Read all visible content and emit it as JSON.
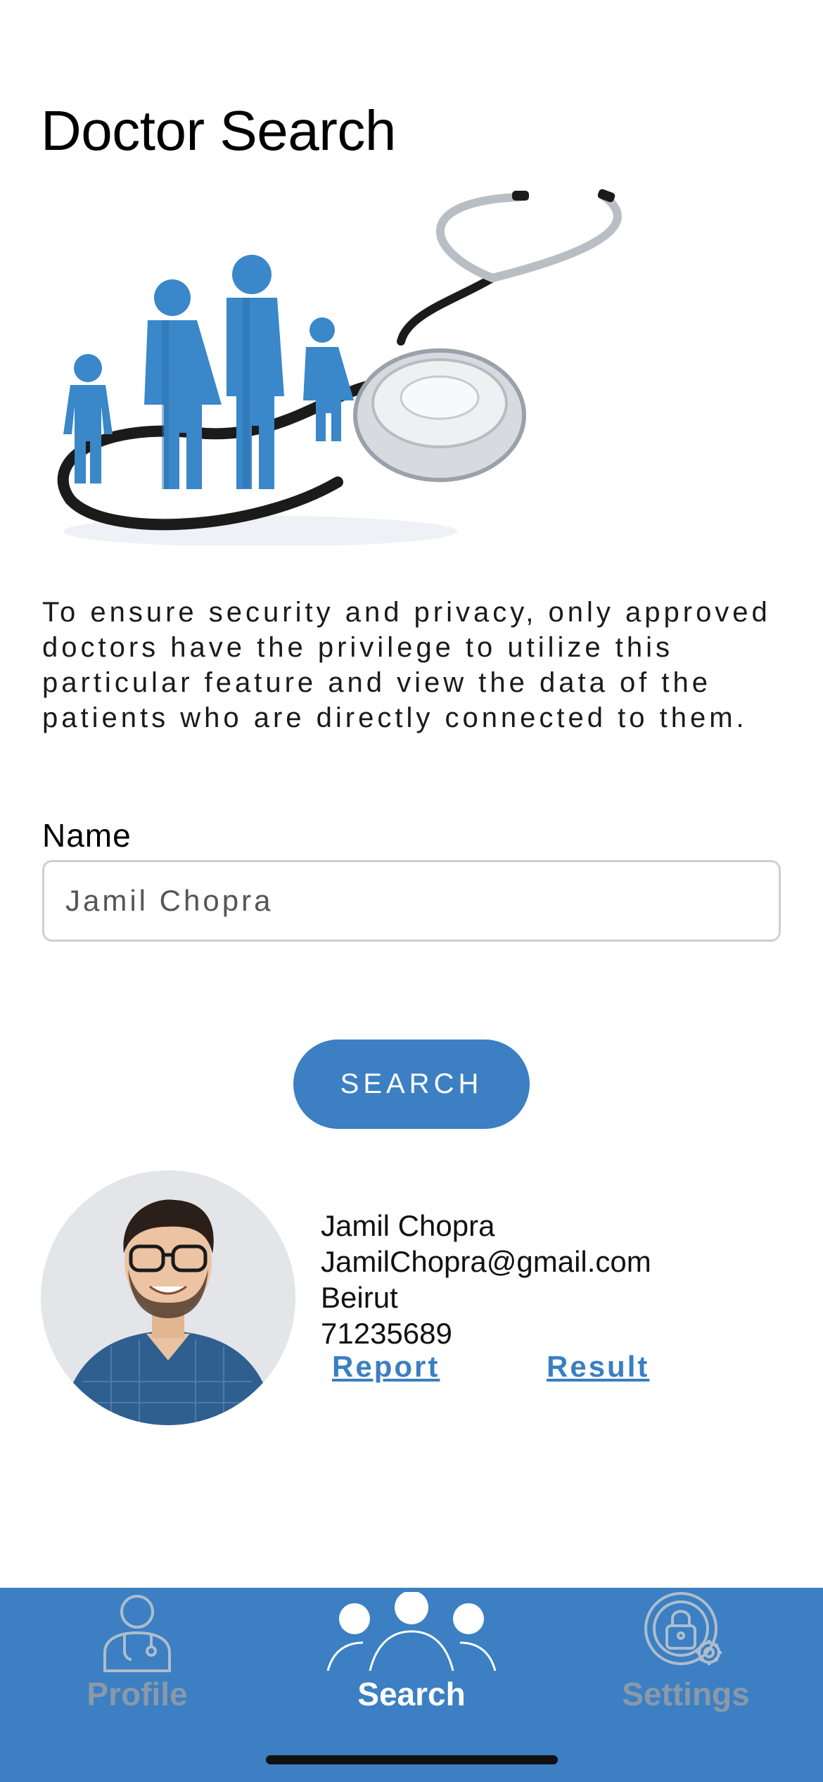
{
  "page": {
    "title": "Doctor Search",
    "notice": "To ensure security and privacy, only approved doctors have the privilege to utilize this particular feature and view the data of the patients who are directly connected to them."
  },
  "form": {
    "name_label": "Name",
    "name_value": "Jamil Chopra",
    "search_label": "SEARCH"
  },
  "result": {
    "name": "Jamil Chopra",
    "email": "JamilChopra@gmail.com",
    "city": "Beirut",
    "phone": "71235689",
    "report_link": "Report",
    "result_link": "Result"
  },
  "tabs": [
    {
      "label": "Profile",
      "icon": "doctor-icon",
      "active": false
    },
    {
      "label": "Search",
      "icon": "people-icon",
      "active": true
    },
    {
      "label": "Settings",
      "icon": "lock-gear-icon",
      "active": false
    }
  ],
  "colors": {
    "accent": "#3c7fc3",
    "inactive_tab": "#8a99a8",
    "link": "#3a7fc1"
  }
}
